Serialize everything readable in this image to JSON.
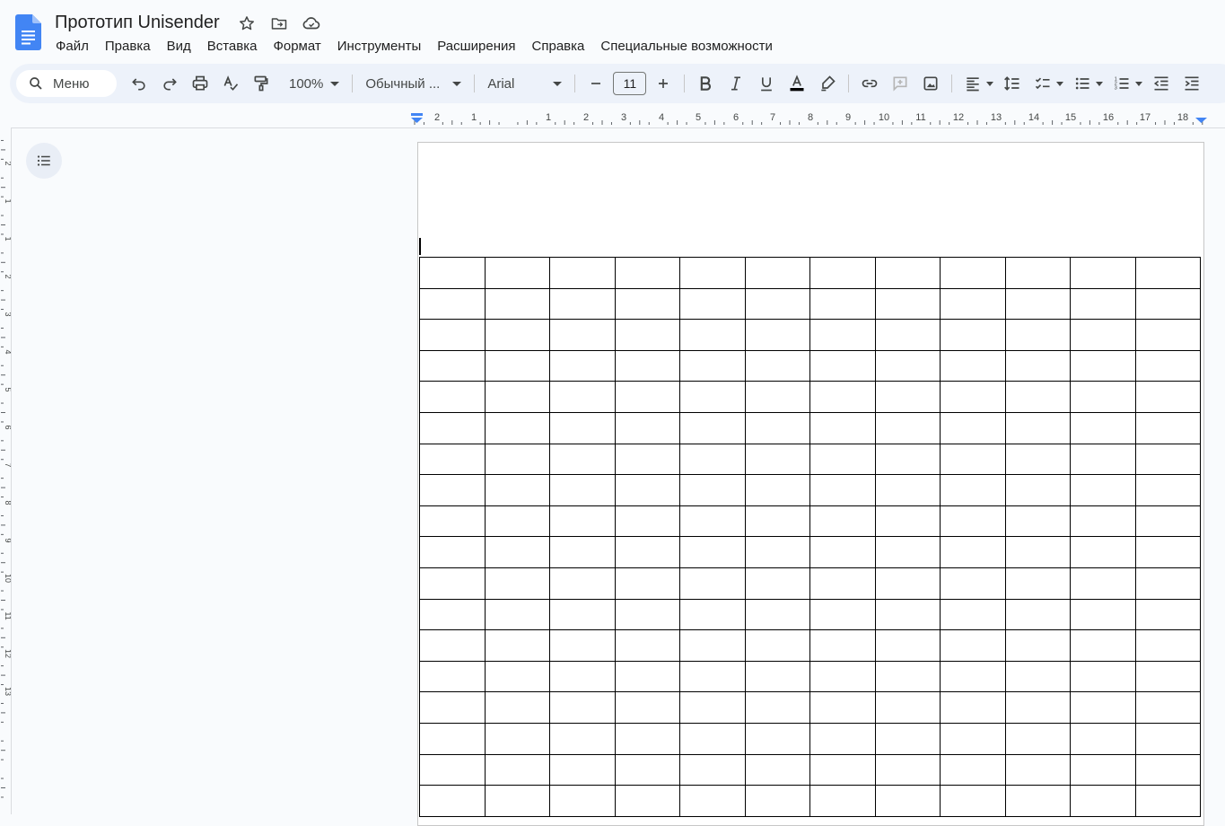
{
  "doc": {
    "title": "Прототип Unisender"
  },
  "menu": [
    "Файл",
    "Правка",
    "Вид",
    "Вставка",
    "Формат",
    "Инструменты",
    "Расширения",
    "Справка",
    "Специальные возможности"
  ],
  "toolbar": {
    "search_label": "Меню",
    "zoom": "100%",
    "style": "Обычный ...",
    "font": "Arial",
    "font_size": "11"
  },
  "hruler": {
    "labels": [
      "2",
      "1",
      "",
      "1",
      "2",
      "3",
      "4",
      "5",
      "6",
      "7",
      "8",
      "9",
      "10",
      "11",
      "12",
      "13",
      "14",
      "15",
      "16",
      "17",
      "18"
    ]
  },
  "vruler": {
    "labels": [
      "2",
      "1",
      "1",
      "2",
      "3",
      "4",
      "5",
      "6",
      "7",
      "8",
      "9",
      "10",
      "11",
      "12",
      "13"
    ]
  },
  "table": {
    "rows": 18,
    "cols": 12
  },
  "colors": {
    "docs_blue": "#4285f4",
    "toolbar_bg": "#edf2fa",
    "page_bg": "#f9fbfd"
  }
}
